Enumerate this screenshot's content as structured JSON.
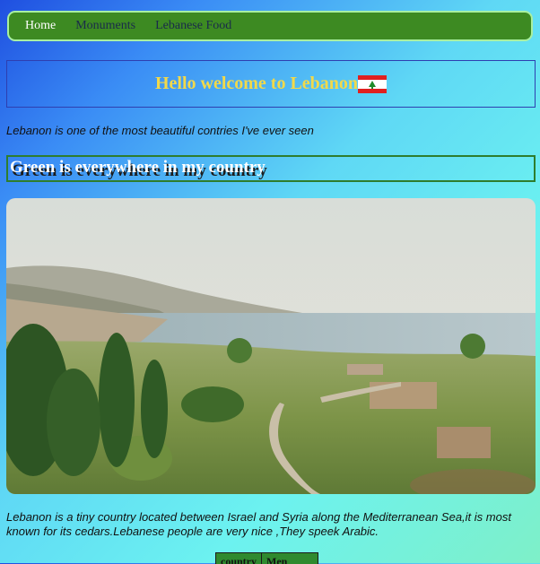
{
  "nav": {
    "items": [
      {
        "label": "Home"
      },
      {
        "label": "Monuments"
      },
      {
        "label": "Lebanese Food"
      }
    ]
  },
  "welcome": {
    "title": "Hello welcome to Lebanon"
  },
  "intro_text": "Lebanon is one of the most beautiful contries I've ever seen",
  "green_heading": "Green is everywhere in my country",
  "description": "Lebanon is a tiny country located between Israel and Syria along the Mediterranean Sea,it is most known for its cedars.Lebanese people are very nice ,They speek Arabic.",
  "table": {
    "headers": [
      "country",
      "Men"
    ]
  },
  "icons": {
    "flag": "lebanon-flag-icon",
    "photo": "landscape-photo"
  },
  "colors": {
    "nav_bg": "#3d8a22",
    "title": "#f2d94a",
    "table_bg": "#2f8a2f"
  }
}
